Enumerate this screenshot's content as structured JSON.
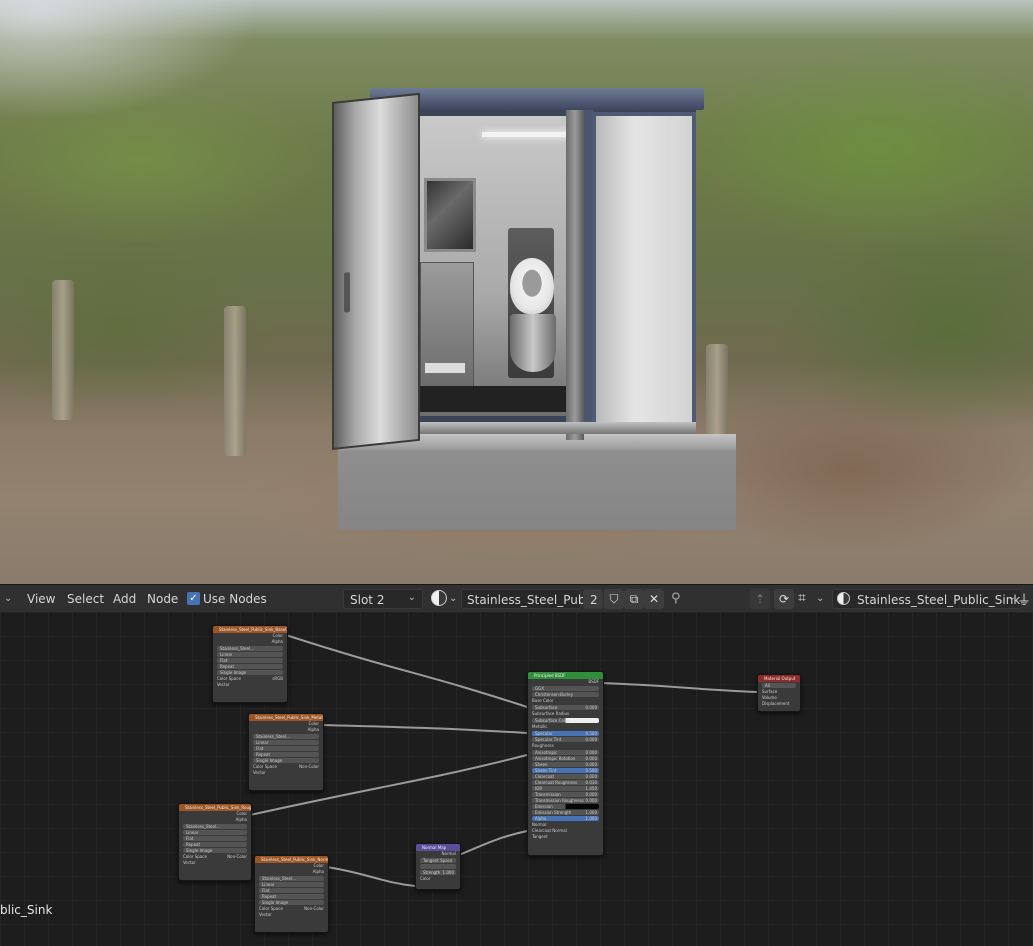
{
  "header": {
    "menu": [
      "View",
      "Select",
      "Add",
      "Node"
    ],
    "use_nodes_label": "Use Nodes",
    "slot_label": "Slot 2",
    "material_name": "Stainless_Steel_Publ...",
    "user_count": "2",
    "object_name": "Stainless_Steel_Public_Sink"
  },
  "canvas_left_label": "blic_Sink",
  "nodes": {
    "tex1": {
      "title": "Stainless_Steel_Public_Sink_BaseColor",
      "outputs": [
        "Color",
        "Alpha"
      ],
      "image": "Stainless_Steel...",
      "interp": "Linear",
      "proj": "Flat",
      "ext": "Repeat",
      "src": "Single Image",
      "cs_label": "Color Space",
      "cs_value": "sRGB",
      "vec": "Vector"
    },
    "tex2": {
      "title": "Stainless_Steel_Public_Sink_Metallic",
      "outputs": [
        "Color",
        "Alpha"
      ],
      "image": "Stainless_Steel...",
      "interp": "Linear",
      "proj": "Flat",
      "ext": "Repeat",
      "src": "Single Image",
      "cs_label": "Color Space",
      "cs_value": "Non-Color",
      "vec": "Vector"
    },
    "tex3": {
      "title": "Stainless_Steel_Public_Sink_Roughness",
      "outputs": [
        "Color",
        "Alpha"
      ],
      "image": "Stainless_Steel...",
      "interp": "Linear",
      "proj": "Flat",
      "ext": "Repeat",
      "src": "Single Image",
      "cs_label": "Color Space",
      "cs_value": "Non-Color",
      "vec": "Vector"
    },
    "tex4": {
      "title": "Stainless_Steel_Public_Sink_Normal",
      "outputs": [
        "Color",
        "Alpha"
      ],
      "image": "Stainless_Steel...",
      "interp": "Linear",
      "proj": "Flat",
      "ext": "Repeat",
      "src": "Single Image",
      "cs_label": "Color Space",
      "cs_value": "Non-Color",
      "vec": "Vector"
    },
    "bsdf": {
      "title": "Principled BSDF",
      "output": "BSDF",
      "dist": "GGX",
      "sss": "Christensen-Burley",
      "rows": [
        {
          "label": "Base Color",
          "value": "",
          "style": "socket"
        },
        {
          "label": "Subsurface",
          "value": "0.000",
          "style": "field"
        },
        {
          "label": "Subsurface Radius",
          "value": "",
          "style": "socket"
        },
        {
          "label": "Subsurface Color",
          "value": "",
          "style": "white"
        },
        {
          "label": "Metallic",
          "value": "",
          "style": "socket"
        },
        {
          "label": "Specular",
          "value": "0.500",
          "style": "blue"
        },
        {
          "label": "Specular Tint",
          "value": "0.000",
          "style": "field"
        },
        {
          "label": "Roughness",
          "value": "",
          "style": "socket"
        },
        {
          "label": "Anisotropic",
          "value": "0.000",
          "style": "field"
        },
        {
          "label": "Anisotropic Rotation",
          "value": "0.000",
          "style": "field"
        },
        {
          "label": "Sheen",
          "value": "0.000",
          "style": "field"
        },
        {
          "label": "Sheen Tint",
          "value": "0.500",
          "style": "blue"
        },
        {
          "label": "Clearcoat",
          "value": "0.000",
          "style": "field"
        },
        {
          "label": "Clearcoat Roughness",
          "value": "0.030",
          "style": "field"
        },
        {
          "label": "IOR",
          "value": "1.450",
          "style": "field"
        },
        {
          "label": "Transmission",
          "value": "0.000",
          "style": "field"
        },
        {
          "label": "Transmission Roughness",
          "value": "0.000",
          "style": "field"
        },
        {
          "label": "Emission",
          "value": "",
          "style": "black"
        },
        {
          "label": "Emission Strength",
          "value": "1.000",
          "style": "field"
        },
        {
          "label": "Alpha",
          "value": "1.000",
          "style": "blue"
        },
        {
          "label": "Normal",
          "value": "",
          "style": "socket"
        },
        {
          "label": "Clearcoat Normal",
          "value": "",
          "style": "socket"
        },
        {
          "label": "Tangent",
          "value": "",
          "style": "socket"
        }
      ]
    },
    "out": {
      "title": "Material Output",
      "target": "All",
      "inputs": [
        "Surface",
        "Volume",
        "Displacement"
      ]
    },
    "nmap": {
      "title": "Normal Map",
      "output": "Normal",
      "space_label": "Tangent Space",
      "strength_label": "Strength",
      "strength": "1.000",
      "color": "Color"
    }
  }
}
